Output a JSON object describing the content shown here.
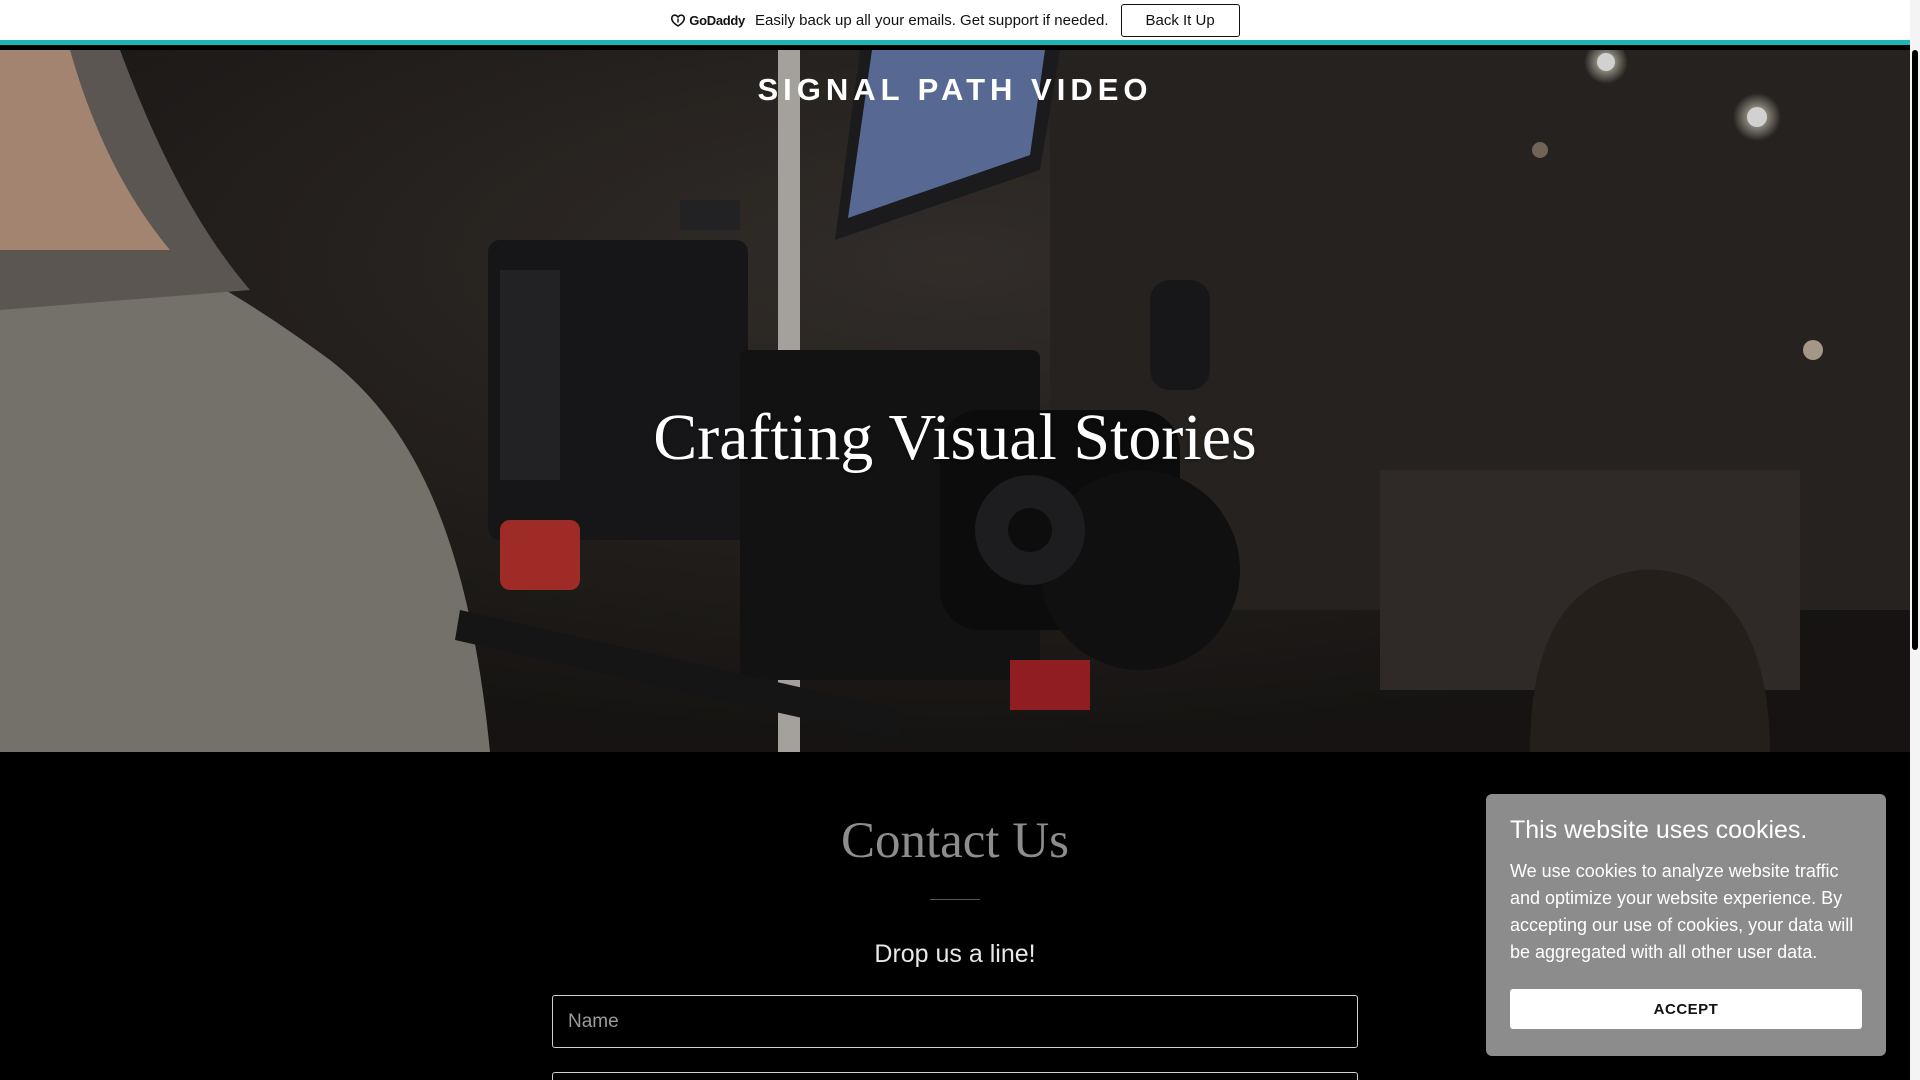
{
  "promo": {
    "brand": "GoDaddy",
    "message": "Easily back up all your emails. Get support if needed.",
    "button_label": "Back It Up"
  },
  "hero": {
    "site_title": "SIGNAL PATH VIDEO",
    "heading": "Crafting Visual Stories"
  },
  "contact": {
    "title": "Contact Us",
    "subtitle": "Drop us a line!",
    "name_placeholder": "Name",
    "email_placeholder": ""
  },
  "cookie": {
    "title": "This website uses cookies.",
    "body": "We use cookies to analyze website traffic and optimize your website experience. By accepting our use of cookies, your data will be aggregated with all other user data.",
    "accept_label": "ACCEPT"
  },
  "colors": {
    "accent": "#1bb5b5",
    "cookie_bg": "#8c8c8c",
    "contact_title": "#8d8d8d"
  }
}
